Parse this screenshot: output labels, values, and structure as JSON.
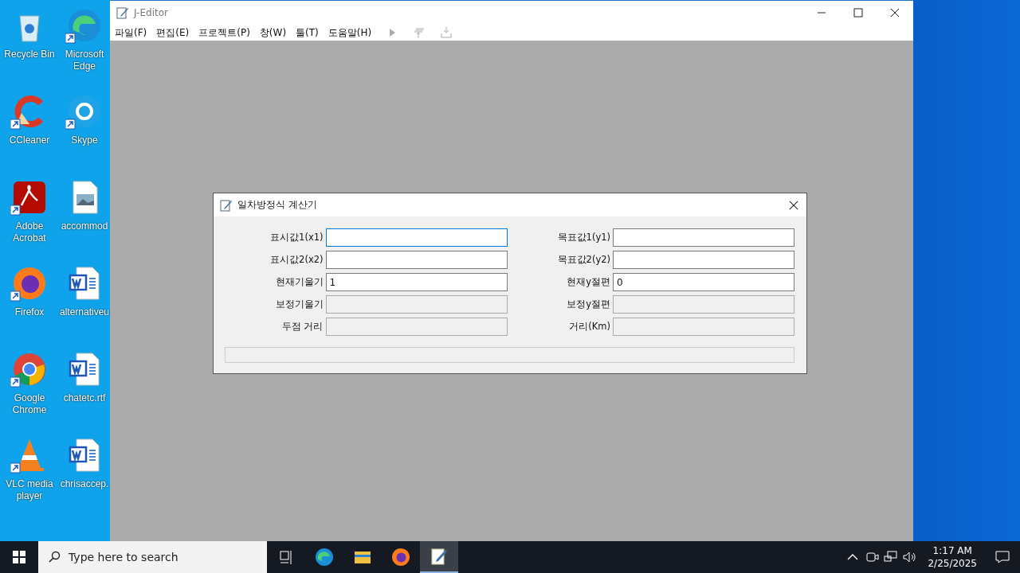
{
  "desktop": {
    "icons": [
      {
        "label": "Recycle Bin",
        "kind": "bin",
        "shortcut": false
      },
      {
        "label": "Microsoft Edge",
        "kind": "edge",
        "shortcut": true
      },
      {
        "label": "CCleaner",
        "kind": "ccleaner",
        "shortcut": true
      },
      {
        "label": "Skype",
        "kind": "skype",
        "shortcut": true
      },
      {
        "label": "Adobe Acrobat",
        "kind": "acrobat",
        "shortcut": true
      },
      {
        "label": "accommod",
        "kind": "image-doc",
        "shortcut": false
      },
      {
        "label": "Firefox",
        "kind": "firefox",
        "shortcut": true
      },
      {
        "label": "alternativeu",
        "kind": "word-doc",
        "shortcut": false
      },
      {
        "label": "Google Chrome",
        "kind": "chrome",
        "shortcut": true
      },
      {
        "label": "chatetc.rtf",
        "kind": "word-doc",
        "shortcut": false
      },
      {
        "label": "VLC media player",
        "kind": "vlc",
        "shortcut": true
      },
      {
        "label": "chrisaccep.",
        "kind": "word-doc",
        "shortcut": false
      }
    ]
  },
  "window": {
    "title": "J-Editor",
    "menu": [
      "파일(F)",
      "편집(E)",
      "프로젝트(P)",
      "창(W)",
      "툴(T)",
      "도움말(H)"
    ],
    "toolbar": [
      {
        "kind": "run",
        "disabled": true
      },
      {
        "kind": "stack",
        "disabled": true
      },
      {
        "kind": "download",
        "disabled": true
      }
    ]
  },
  "dialog": {
    "title": "일차방정식 계산기",
    "left": [
      {
        "label": "표시값1(x1)",
        "disabled": false,
        "focused": true
      },
      {
        "label": "표시값2(x2)",
        "disabled": false,
        "focused": false
      },
      {
        "label": "현재기울기",
        "value": "1",
        "disabled": false,
        "focused": false
      },
      {
        "label": "보정기울기",
        "disabled": true,
        "focused": false
      },
      {
        "label": "두점 거리",
        "disabled": true,
        "focused": false
      }
    ],
    "right": [
      {
        "label": "목표값1(y1)",
        "disabled": false,
        "focused": false
      },
      {
        "label": "목표값2(y2)",
        "disabled": false,
        "focused": false
      },
      {
        "label": "현재y절편",
        "value": "0",
        "disabled": false,
        "focused": false
      },
      {
        "label": "보정y절편",
        "disabled": true,
        "focused": false
      },
      {
        "label": "거리(Km)",
        "disabled": true,
        "focused": false
      }
    ]
  },
  "taskbar": {
    "search": {
      "placeholder": "Type here to search"
    },
    "apps": [
      {
        "kind": "edge",
        "selected": false
      },
      {
        "kind": "explorer",
        "selected": false
      },
      {
        "kind": "firefox",
        "selected": false
      },
      {
        "kind": "editor",
        "selected": true
      }
    ],
    "time": "1:17 AM",
    "date": "2/25/2025"
  }
}
